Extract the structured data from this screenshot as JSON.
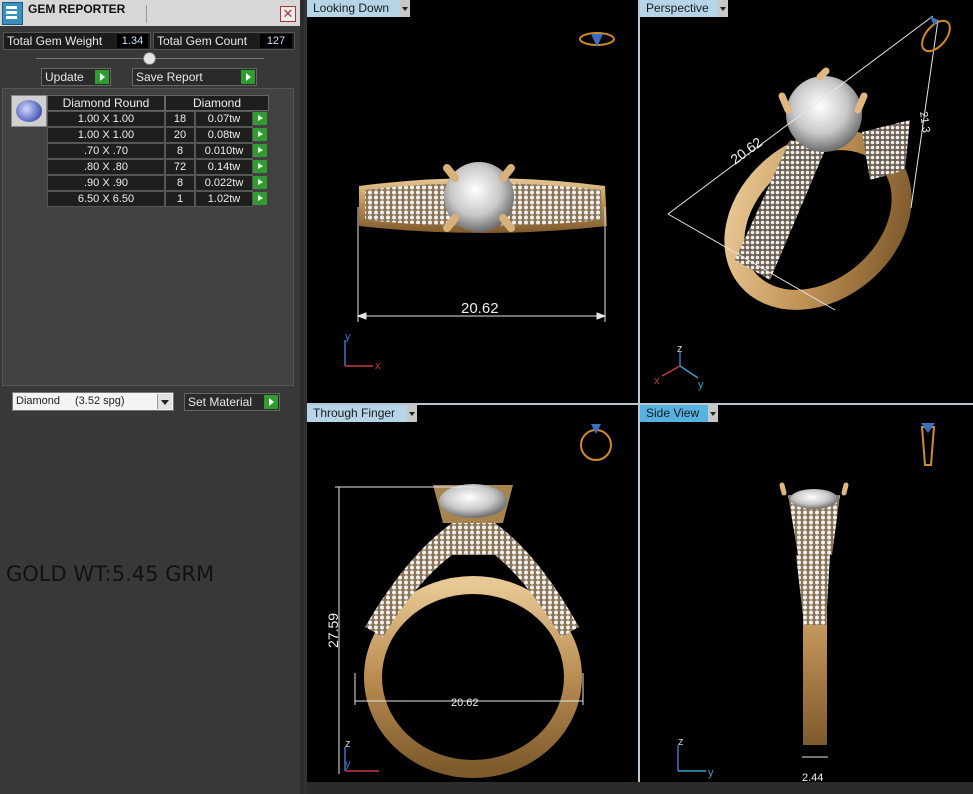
{
  "panel": {
    "title": "GEM REPORTER",
    "close_label": "✕",
    "total_gem_weight_label": "Total Gem Weight",
    "total_gem_weight_value": "1.34",
    "total_gem_count_label": "Total Gem Count",
    "total_gem_count_value": "127",
    "update_label": "Update",
    "save_report_label": "Save Report",
    "table": {
      "header_shape": "Diamond Round",
      "header_material": "Diamond",
      "rows": [
        {
          "size": "1.00 X 1.00",
          "count": "18",
          "weight": "0.07tw"
        },
        {
          "size": "1.00 X 1.00",
          "count": "20",
          "weight": "0.08tw"
        },
        {
          "size": ".70 X .70",
          "count": "8",
          "weight": "0.010tw"
        },
        {
          "size": ".80 X .80",
          "count": "72",
          "weight": "0.14tw"
        },
        {
          "size": ".90 X .90",
          "count": "8",
          "weight": "0.022tw"
        },
        {
          "size": "6.50 X 6.50",
          "count": "1",
          "weight": "1.02tw"
        }
      ]
    },
    "material_select": {
      "material": "Diamond",
      "density": "(3.52 spg)"
    },
    "set_material_label": "Set Material",
    "gold_weight_note": "GOLD WT:5.45 GRM"
  },
  "viewports": {
    "top_left": {
      "label": "Looking Down",
      "dimension": "20.62",
      "axis_a": "y",
      "axis_b": "x"
    },
    "top_right": {
      "label": "Perspective",
      "dimension_diagonal": "20.62",
      "dimension_vertical": "21.3",
      "axis_z": "z",
      "axis_x": "x",
      "axis_y": "y"
    },
    "bottom_left": {
      "label": "Through Finger",
      "dimension_height": "27.59",
      "dimension_width": "20.62",
      "axis_z": "z",
      "axis_y": "y"
    },
    "bottom_right": {
      "label": "Side View",
      "dimension_width": "2.44",
      "axis_z": "z",
      "axis_y": "y"
    }
  },
  "colors": {
    "gold": "#c9a066",
    "active_tab": "#56b2e0",
    "tab": "#b6d6e8",
    "play": "#2e9c2e"
  },
  "icons": {
    "app": "gem-reporter-icon",
    "play": "play-arrow-icon",
    "dropdown": "chevron-down-icon"
  }
}
